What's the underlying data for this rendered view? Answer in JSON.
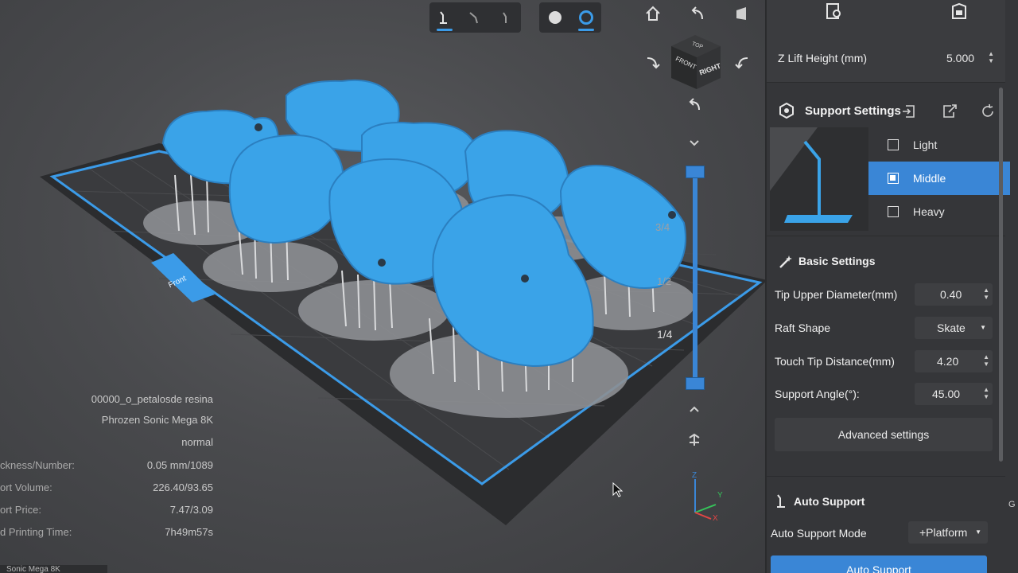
{
  "toolbar": {
    "support_tools": [
      "support-edit-icon",
      "support-add-icon",
      "support-remove-icon"
    ],
    "view_modes": [
      "solid-view-icon",
      "xray-view-icon"
    ]
  },
  "view_nav": {
    "cube_faces": {
      "top": "TOP",
      "front": "FRONT",
      "right": "RIGHT"
    },
    "icons": [
      "home-icon",
      "rotate-left-icon",
      "perspective-icon",
      "rotate-ccw-icon",
      "rotate-cw-icon",
      "reset-rotation-icon"
    ]
  },
  "slider": {
    "labels": [
      "3/4",
      "1/2",
      "1/4"
    ],
    "level": 1.0,
    "icons": [
      "chevron-down-icon",
      "chevron-up-icon",
      "layer-jump-icon"
    ]
  },
  "plate": {
    "front_label": "Front"
  },
  "axes": {
    "x": "X",
    "y": "Y",
    "z": "Z"
  },
  "info": {
    "file_name": "00000_o_petalosde resina",
    "printer": "Phrozen Sonic Mega 8K",
    "mode": "normal",
    "rows": [
      {
        "label": "ckness/Number:",
        "value": "0.05 mm/1089"
      },
      {
        "label": "ort Volume:",
        "value": "226.40/93.65"
      },
      {
        "label": "ort Price:",
        "value": "7.47/3.09"
      },
      {
        "label": "d Printing Time:",
        "value": "7h49m57s"
      }
    ]
  },
  "panel": {
    "top_icons": [
      "model-settings-icon",
      "printer-icon"
    ],
    "z_lift": {
      "label": "Z Lift Height (mm)",
      "value": "5.000"
    },
    "support_settings": {
      "title": "Support Settings",
      "icons": [
        "import-icon",
        "export-icon",
        "reset-icon"
      ],
      "presets": [
        "Light",
        "Middle",
        "Heavy"
      ],
      "selected": "Middle"
    },
    "basic_settings": {
      "title": "Basic Settings",
      "tip_upper": {
        "label": "Tip Upper Diameter(mm)",
        "value": "0.40"
      },
      "raft_shape": {
        "label": "Raft Shape",
        "value": "Skate"
      },
      "touch_tip": {
        "label": "Touch Tip Distance(mm)",
        "value": "4.20"
      },
      "support_angle": {
        "label": "Support Angle(°):",
        "value": "45.00"
      },
      "advanced": "Advanced settings"
    },
    "auto_support": {
      "title": "Auto Support",
      "mode_label": "Auto Support Mode",
      "mode_value": "+Platform",
      "button": "Auto Support"
    }
  },
  "side_text": "G",
  "bottom_tab": "Sonic Mega 8K"
}
